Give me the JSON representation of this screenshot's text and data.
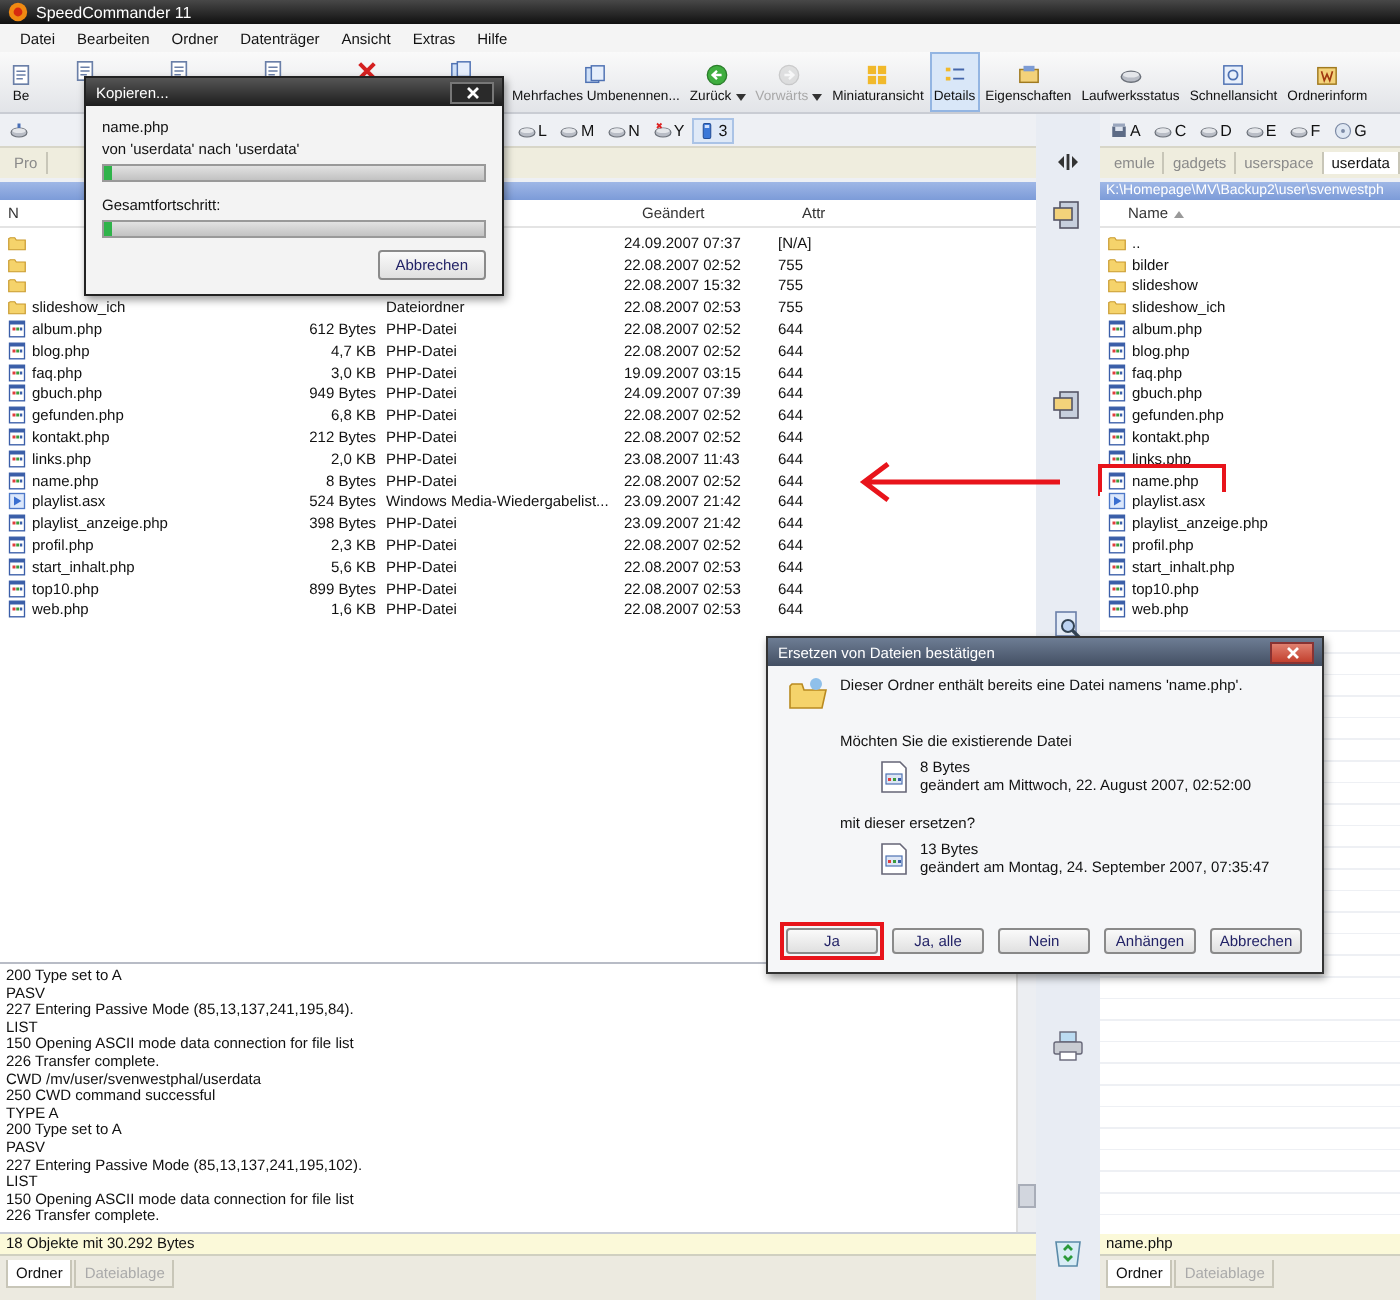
{
  "window": {
    "title": "SpeedCommander 11"
  },
  "menu": [
    "Datei",
    "Bearbeiten",
    "Ordner",
    "Datenträger",
    "Ansicht",
    "Extras",
    "Hilfe"
  ],
  "toolbar": [
    {
      "label": "Be",
      "kind": "doc",
      "dropdown": false,
      "disabled": false,
      "selected": false
    },
    {
      "kind": "doc",
      "dropdown": false,
      "disabled": false,
      "selected": false
    },
    {
      "kind": "doc",
      "dropdown": false,
      "disabled": false,
      "selected": false
    },
    {
      "kind": "doc",
      "dropdown": false,
      "disabled": false,
      "selected": false
    },
    {
      "kind": "delete",
      "dropdown": false,
      "disabled": false,
      "selected": false
    },
    {
      "kind": "rename",
      "dropdown": false,
      "disabled": false,
      "selected": false
    },
    {
      "label": "Mehrfaches Umbenennen...",
      "kind": "rename",
      "dropdown": false,
      "disabled": false,
      "selected": false
    },
    {
      "label": "Zurück",
      "kind": "back",
      "dropdown": true,
      "disabled": false,
      "selected": false
    },
    {
      "label": "Vorwärts",
      "kind": "forward",
      "dropdown": true,
      "disabled": true,
      "selected": false
    },
    {
      "label": "Miniaturansicht",
      "kind": "thumbs",
      "dropdown": false,
      "disabled": false,
      "selected": false
    },
    {
      "label": "Details",
      "kind": "details",
      "dropdown": false,
      "disabled": false,
      "selected": true
    },
    {
      "label": "Eigenschaften",
      "kind": "props",
      "dropdown": false,
      "disabled": false,
      "selected": false
    },
    {
      "label": "Laufwerksstatus",
      "kind": "drive",
      "dropdown": false,
      "disabled": false,
      "selected": false
    },
    {
      "label": "Schnellansicht",
      "kind": "quickview",
      "dropdown": false,
      "disabled": false,
      "selected": false
    },
    {
      "label": "Ordnerinform",
      "kind": "info",
      "dropdown": false,
      "disabled": false,
      "selected": false
    }
  ],
  "left": {
    "drives": [
      {
        "kind": "net",
        "selected": false
      },
      {
        "label": "L",
        "kind": "drive",
        "selected": false
      },
      {
        "label": "M",
        "kind": "drive",
        "selected": false
      },
      {
        "label": "N",
        "kind": "drive",
        "selected": false
      },
      {
        "label": "Y",
        "kind": "netx",
        "selected": false
      },
      {
        "label": "3",
        "kind": "usb",
        "selected": true
      }
    ],
    "tabs": [
      {
        "label": "Pro",
        "selected": false
      }
    ],
    "columns": {
      "name": "N",
      "modified": "Geändert",
      "attr": "Attr"
    },
    "rows": [
      {
        "kind": "folder",
        "modified": "24.09.2007 07:37",
        "attr": "[N/A]"
      },
      {
        "kind": "folder",
        "modified": "22.08.2007 02:52",
        "attr": "755"
      },
      {
        "kind": "folder",
        "modified": "22.08.2007 15:32",
        "attr": "755"
      },
      {
        "kind": "folder",
        "name": "slideshow_ich",
        "type": "Dateiordner",
        "modified": "22.08.2007 02:53",
        "attr": "755"
      },
      {
        "kind": "php",
        "name": "album.php",
        "size": "612 Bytes",
        "type": "PHP-Datei",
        "modified": "22.08.2007 02:52",
        "attr": "644"
      },
      {
        "kind": "php",
        "name": "blog.php",
        "size": "4,7 KB",
        "type": "PHP-Datei",
        "modified": "22.08.2007 02:52",
        "attr": "644"
      },
      {
        "kind": "php",
        "name": "faq.php",
        "size": "3,0 KB",
        "type": "PHP-Datei",
        "modified": "19.09.2007 03:15",
        "attr": "644"
      },
      {
        "kind": "php",
        "name": "gbuch.php",
        "size": "949 Bytes",
        "type": "PHP-Datei",
        "modified": "24.09.2007 07:39",
        "attr": "644"
      },
      {
        "kind": "php",
        "name": "gefunden.php",
        "size": "6,8 KB",
        "type": "PHP-Datei",
        "modified": "22.08.2007 02:52",
        "attr": "644"
      },
      {
        "kind": "php",
        "name": "kontakt.php",
        "size": "212 Bytes",
        "type": "PHP-Datei",
        "modified": "22.08.2007 02:52",
        "attr": "644"
      },
      {
        "kind": "php",
        "name": "links.php",
        "size": "2,0 KB",
        "type": "PHP-Datei",
        "modified": "23.08.2007 11:43",
        "attr": "644"
      },
      {
        "kind": "php",
        "name": "name.php",
        "size": "8 Bytes",
        "type": "PHP-Datei",
        "modified": "22.08.2007 02:52",
        "attr": "644"
      },
      {
        "kind": "asx",
        "name": "playlist.asx",
        "size": "524 Bytes",
        "type": "Windows Media-Wiedergabelist...",
        "modified": "23.09.2007 21:42",
        "attr": "644"
      },
      {
        "kind": "php",
        "name": "playlist_anzeige.php",
        "size": "398 Bytes",
        "type": "PHP-Datei",
        "modified": "23.09.2007 21:42",
        "attr": "644"
      },
      {
        "kind": "php",
        "name": "profil.php",
        "size": "2,3 KB",
        "type": "PHP-Datei",
        "modified": "22.08.2007 02:52",
        "attr": "644"
      },
      {
        "kind": "php",
        "name": "start_inhalt.php",
        "size": "5,6 KB",
        "type": "PHP-Datei",
        "modified": "22.08.2007 02:53",
        "attr": "644"
      },
      {
        "kind": "php",
        "name": "top10.php",
        "size": "899 Bytes",
        "type": "PHP-Datei",
        "modified": "22.08.2007 02:53",
        "attr": "644"
      },
      {
        "kind": "php",
        "name": "web.php",
        "size": "1,6 KB",
        "type": "PHP-Datei",
        "modified": "22.08.2007 02:53",
        "attr": "644"
      }
    ],
    "log": [
      "200 Type set to A",
      "PASV",
      "227 Entering Passive Mode (85,13,137,241,195,84).",
      "LIST",
      "150 Opening ASCII mode data connection for file list",
      "226 Transfer complete.",
      "CWD /mv/user/svenwestphal/userdata",
      "250 CWD command successful",
      "TYPE A",
      "200 Type set to A",
      "PASV",
      "227 Entering Passive Mode (85,13,137,241,195,102).",
      "LIST",
      "150 Opening ASCII mode data connection for file list",
      "226 Transfer complete."
    ],
    "status": "18 Objekte mit 30.292 Bytes",
    "bottom_tabs": [
      {
        "label": "Ordner",
        "selected": true
      },
      {
        "label": "Dateiablage",
        "selected": false
      }
    ]
  },
  "right": {
    "drives": [
      {
        "label": "A",
        "kind": "floppy",
        "selected": false
      },
      {
        "label": "C",
        "kind": "drive",
        "selected": false
      },
      {
        "label": "D",
        "kind": "drive",
        "selected": false
      },
      {
        "label": "E",
        "kind": "drive",
        "selected": false
      },
      {
        "label": "F",
        "kind": "drive",
        "selected": false
      },
      {
        "label": "G",
        "kind": "cd",
        "selected": false
      }
    ],
    "tabs": [
      {
        "label": "emule",
        "selected": false
      },
      {
        "label": "gadgets",
        "selected": false
      },
      {
        "label": "userspace",
        "selected": false
      },
      {
        "label": "userdata",
        "selected": true
      }
    ],
    "path": "K:\\Homepage\\MV\\Backup2\\user\\svenwestph",
    "columns": {
      "name": "Name"
    },
    "rows": [
      {
        "kind": "folder",
        "name": "..",
        "marked": false
      },
      {
        "kind": "folder",
        "name": "bilder",
        "marked": false
      },
      {
        "kind": "folder",
        "name": "slideshow",
        "marked": false
      },
      {
        "kind": "folder",
        "name": "slideshow_ich",
        "marked": false
      },
      {
        "kind": "php",
        "name": "album.php",
        "marked": false
      },
      {
        "kind": "php",
        "name": "blog.php",
        "marked": false
      },
      {
        "kind": "php",
        "name": "faq.php",
        "marked": false
      },
      {
        "kind": "php",
        "name": "gbuch.php",
        "marked": false
      },
      {
        "kind": "php",
        "name": "gefunden.php",
        "marked": false
      },
      {
        "kind": "php",
        "name": "kontakt.php",
        "marked": false
      },
      {
        "kind": "php",
        "name": "links.php",
        "marked": false
      },
      {
        "kind": "php",
        "name": "name.php",
        "marked": true
      },
      {
        "kind": "asx",
        "name": "playlist.asx",
        "marked": false
      },
      {
        "kind": "php",
        "name": "playlist_anzeige.php",
        "marked": false
      },
      {
        "kind": "php",
        "name": "profil.php",
        "marked": false
      },
      {
        "kind": "php",
        "name": "start_inhalt.php",
        "marked": false
      },
      {
        "kind": "php",
        "name": "top10.php",
        "marked": false
      },
      {
        "kind": "php",
        "name": "web.php",
        "marked": false
      }
    ],
    "status": "name.php",
    "bottom_tabs": [
      {
        "label": "Ordner",
        "selected": true
      },
      {
        "label": "Dateiablage",
        "selected": false
      }
    ]
  },
  "copy_dialog": {
    "title": "Kopieren...",
    "file": "name.php",
    "route": "von 'userdata' nach 'userdata'",
    "file_progress": {
      "level": 0.02
    },
    "total_label": "Gesamtfortschritt:",
    "total_progress": {
      "level": 0.02
    },
    "cancel": "Abbrechen"
  },
  "replace_dialog": {
    "title": "Ersetzen von Dateien bestätigen",
    "message": "Dieser Ordner enthält bereits eine Datei namens 'name.php'.",
    "question": "Möchten Sie die existierende Datei",
    "existing": {
      "size": "8 Bytes",
      "modified": "geändert am Mittwoch, 22. August 2007, 02:52:00"
    },
    "question2": "mit dieser ersetzen?",
    "replacement": {
      "size": "13 Bytes",
      "modified": "geändert am Montag, 24. September 2007, 07:35:47"
    },
    "buttons": [
      {
        "label": "Ja",
        "marked": true
      },
      {
        "label": "Ja, alle",
        "marked": false
      },
      {
        "label": "Nein",
        "marked": false
      },
      {
        "label": "Anhängen",
        "marked": false
      },
      {
        "label": "Abbrechen",
        "marked": false
      }
    ]
  }
}
